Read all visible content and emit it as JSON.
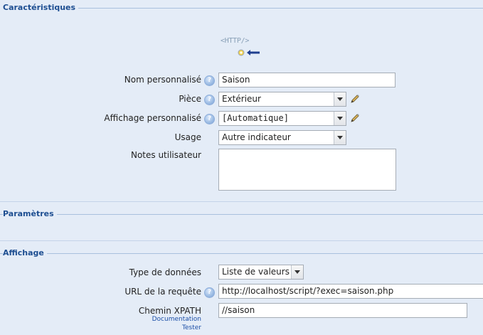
{
  "sections": {
    "characteristics": "Caractéristiques",
    "parameters": "Paramètres",
    "display": "Affichage"
  },
  "device_icon": {
    "icon": "http-device-icon",
    "text": "<HTTP/>"
  },
  "fields": {
    "custom_name": {
      "label": "Nom personnalisé",
      "value": "Saison"
    },
    "room": {
      "label": "Pièce",
      "value": "Extérieur"
    },
    "custom_display": {
      "label": "Affichage personnalisé",
      "value": "[Automatique]"
    },
    "usage": {
      "label": "Usage",
      "value": "Autre indicateur"
    },
    "user_notes": {
      "label": "Notes utilisateur",
      "value": ""
    },
    "data_type": {
      "label": "Type de données",
      "value": "Liste de valeurs"
    },
    "request_url": {
      "label": "URL de la requête",
      "value": "http://localhost/script/?exec=saison.php"
    },
    "xpath": {
      "label": "Chemin XPATH",
      "value": "//saison",
      "links": [
        "Documentation",
        "Tester"
      ]
    }
  },
  "help_glyph": "?",
  "colors": {
    "background": "#e4ecf7",
    "section_title": "#1d4e91",
    "link": "#1c4fa7"
  }
}
